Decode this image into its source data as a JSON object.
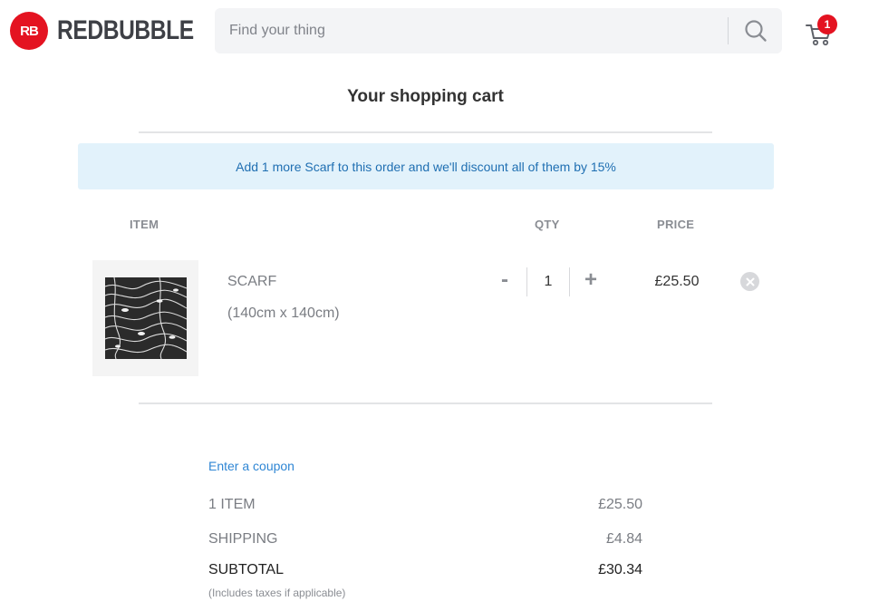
{
  "header": {
    "logo_mark": "RB",
    "logo_text": "REDBUBBLE",
    "search_placeholder": "Find your thing",
    "cart_count": "1"
  },
  "cart": {
    "title": "Your shopping cart",
    "notice": "Add 1 more Scarf to this order and we'll discount all of them by 15%",
    "columns": {
      "item": "ITEM",
      "qty": "QTY",
      "price": "PRICE"
    },
    "items": [
      {
        "name": "SCARF",
        "size": "(140cm x 140cm)",
        "qty": "1",
        "qty_minus": "-",
        "qty_plus": "+",
        "price": "£25.50"
      }
    ]
  },
  "summary": {
    "coupon_link": "Enter a coupon",
    "items_label": "1 ITEM",
    "items_value": "£25.50",
    "shipping_label": "SHIPPING",
    "shipping_value": "£4.84",
    "subtotal_label": "SUBTOTAL",
    "subtotal_value": "£30.34",
    "tax_note": "(Includes taxes if applicable)"
  },
  "colors": {
    "brand_red": "#e41321",
    "notice_bg": "#e2f2fb",
    "notice_text": "#1f6fb2",
    "link_blue": "#2f86d4"
  },
  "icons": [
    "search-icon",
    "cart-icon",
    "remove-icon"
  ]
}
